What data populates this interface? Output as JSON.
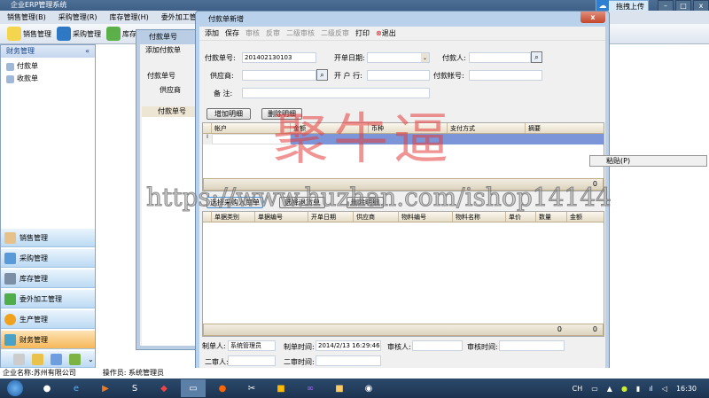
{
  "app": {
    "title": "企业ERP管理系统"
  },
  "menu": [
    "销售管理(B)",
    "采购管理(R)",
    "库存管理(H)",
    "委外加工管理(F)"
  ],
  "toolbar": [
    "销售管理",
    "采购管理",
    "库存管"
  ],
  "left_panel": {
    "header": "财务管理",
    "collapse": "«",
    "items": [
      "付款单",
      "收款单"
    ],
    "nav": [
      "销售管理",
      "采购管理",
      "库存管理",
      "委外加工管理",
      "生产管理",
      "财务管理"
    ],
    "more": "⌄"
  },
  "statusbar": {
    "company": "企业名称:苏州有限公司",
    "operator": "操作员: 系统管理员"
  },
  "bg_window": {
    "title": "付款单号",
    "tool": "添加付款单",
    "label1": "付款单号",
    "label2": "供应商",
    "col": "付款单号"
  },
  "dialog": {
    "title": "付款单新增",
    "close": "x",
    "tools": [
      {
        "label": "添加",
        "enabled": true
      },
      {
        "label": "保存",
        "enabled": true
      },
      {
        "label": "审核",
        "enabled": false
      },
      {
        "label": "反审",
        "enabled": false
      },
      {
        "label": "二级审核",
        "enabled": false
      },
      {
        "label": "二级反审",
        "enabled": false
      },
      {
        "label": "打印",
        "enabled": true
      },
      {
        "label": "退出",
        "enabled": true
      }
    ],
    "fields": {
      "pay_no_label": "付款单号:",
      "pay_no": "201402130103",
      "date_label": "开单日期:",
      "payer_label": "付款人:",
      "supplier_label": "供应商:",
      "bank_label": "开 户 行:",
      "account_label": "付款帐号:",
      "remark_label": "备  注:"
    },
    "buttons": {
      "add_detail": "增加明细",
      "del_detail": "删除明细",
      "select_in": "选择采购入库单",
      "select_ret": "选择退货单",
      "del_detail2": "删除明细"
    },
    "grid1": {
      "columns": [
        "帐户",
        "金额",
        "币种",
        "支付方式",
        "摘要"
      ],
      "total": "0"
    },
    "grid2": {
      "columns": [
        "单据类别",
        "单据编号",
        "开单日期",
        "供应商",
        "物料编号",
        "物料名称",
        "单价",
        "数量",
        "金额"
      ],
      "totals": [
        "0",
        "0"
      ]
    },
    "footer": {
      "maker_label": "制单人:",
      "maker": "系统管理员",
      "make_time_label": "制单时间:",
      "make_time": "2014/2/13 16:29:46",
      "auditor_label": "审核人:",
      "audit_time_label": "审核时间:",
      "auditor2_label": "二审人:",
      "audit2_time_label": "二审时间:"
    }
  },
  "context_menu": {
    "paste": "粘贴(P)"
  },
  "upload": {
    "label": "拖拽上传"
  },
  "watermarks": {
    "brand": "聚牛逼",
    "url": "https://www.huzhan.com/ishop14144"
  },
  "tray": {
    "lang": "CH",
    "time": "16:30"
  },
  "colors": {
    "selected_row": "#7b95d8",
    "active_nav": "#f6b758",
    "watermark": "#e63c3c"
  }
}
